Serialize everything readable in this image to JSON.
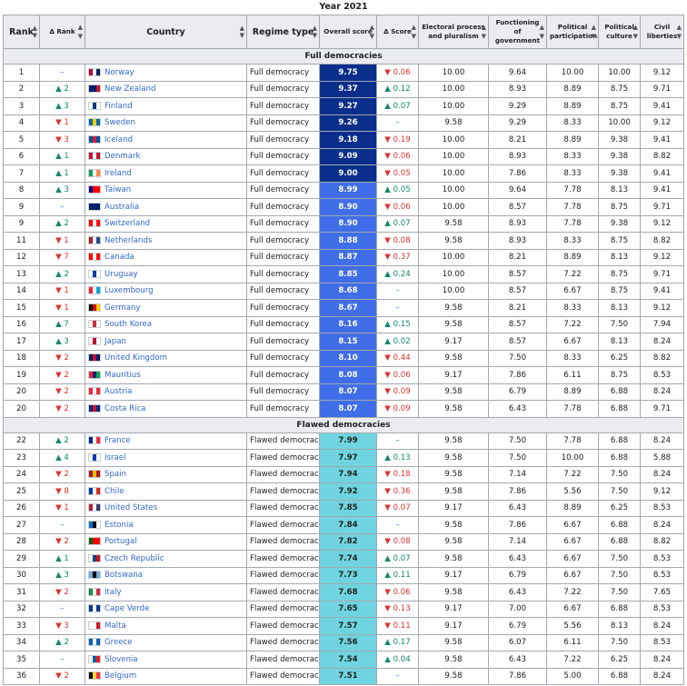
{
  "caption": "Year 2021",
  "columns": {
    "rank": "Rank",
    "delta_rank": "Δ Rank",
    "country": "Country",
    "regime": "Regime type",
    "overall": "Overall score",
    "delta_score": "Δ Score",
    "electoral": "Electoral process and pluralism",
    "functioning": "Functioning of government",
    "participation": "Political participation",
    "culture": "Political culture",
    "liberties": "Civil liberties"
  },
  "colors": {
    "full_dark": "#0b2e8a",
    "full_light": "#3f6ee8",
    "flawed": "#6fd4e0",
    "up": "#14866d",
    "down": "#d33333"
  },
  "sections": [
    {
      "label": "Full democracies",
      "rows": [
        {
          "rank": "1",
          "dr": "–",
          "country": "Norway",
          "regime": "Full democracy",
          "score": "9.75",
          "ds": "▼ 0.06",
          "e": "10.00",
          "f": "9.64",
          "p": "10.00",
          "c": "10.00",
          "l": "9.12",
          "flag": [
            "#ba0c2f",
            "#ffffff",
            "#00205b"
          ]
        },
        {
          "rank": "2",
          "dr": "▲ 2",
          "country": "New Zealand",
          "regime": "Full democracy",
          "score": "9.37",
          "ds": "▲ 0.12",
          "e": "10.00",
          "f": "8.93",
          "p": "8.89",
          "c": "8.75",
          "l": "9.71",
          "flag": [
            "#012169",
            "#012169",
            "#c8102e"
          ]
        },
        {
          "rank": "3",
          "dr": "▲ 3",
          "country": "Finland",
          "regime": "Full democracy",
          "score": "9.27",
          "ds": "▲ 0.07",
          "e": "10.00",
          "f": "9.29",
          "p": "8.89",
          "c": "8.75",
          "l": "9.41",
          "flag": [
            "#ffffff",
            "#003580",
            "#ffffff"
          ]
        },
        {
          "rank": "4",
          "dr": "▼ 1",
          "country": "Sweden",
          "regime": "Full democracy",
          "score": "9.26",
          "ds": "–",
          "e": "9.58",
          "f": "9.29",
          "p": "8.33",
          "c": "10.00",
          "l": "9.12",
          "flag": [
            "#006aa7",
            "#fecc00",
            "#006aa7"
          ]
        },
        {
          "rank": "5",
          "dr": "▼ 3",
          "country": "Iceland",
          "regime": "Full democracy",
          "score": "9.18",
          "ds": "▼ 0.19",
          "e": "10.00",
          "f": "8.21",
          "p": "8.89",
          "c": "9.38",
          "l": "9.41",
          "flag": [
            "#02529c",
            "#dc1e35",
            "#02529c"
          ]
        },
        {
          "rank": "6",
          "dr": "▲ 1",
          "country": "Denmark",
          "regime": "Full democracy",
          "score": "9.09",
          "ds": "▼ 0.06",
          "e": "10.00",
          "f": "8.93",
          "p": "8.33",
          "c": "9.38",
          "l": "8.82",
          "flag": [
            "#c8102e",
            "#ffffff",
            "#c8102e"
          ]
        },
        {
          "rank": "7",
          "dr": "▲ 1",
          "country": "Ireland",
          "regime": "Full democracy",
          "score": "9.00",
          "ds": "▼ 0.05",
          "e": "10.00",
          "f": "7.86",
          "p": "8.33",
          "c": "9.38",
          "l": "9.41",
          "flag": [
            "#169b62",
            "#ffffff",
            "#ff883e"
          ]
        },
        {
          "rank": "8",
          "dr": "▲ 3",
          "country": "Taiwan",
          "regime": "Full democracy",
          "score": "8.99",
          "ds": "▲ 0.05",
          "e": "10.00",
          "f": "9.64",
          "p": "7.78",
          "c": "8.13",
          "l": "9.41",
          "flag": [
            "#000095",
            "#fe0000",
            "#fe0000"
          ]
        },
        {
          "rank": "9",
          "dr": "–",
          "country": "Australia",
          "regime": "Full democracy",
          "score": "8.90",
          "ds": "▼ 0.06",
          "e": "10.00",
          "f": "8.57",
          "p": "7.78",
          "c": "8.75",
          "l": "9.71",
          "flag": [
            "#012169",
            "#012169",
            "#012169"
          ]
        },
        {
          "rank": "9",
          "dr": "▲ 2",
          "country": "Switzerland",
          "regime": "Full democracy",
          "score": "8.90",
          "ds": "▲ 0.07",
          "e": "9.58",
          "f": "8.93",
          "p": "7.78",
          "c": "9.38",
          "l": "9.12",
          "flag": [
            "#ff0000",
            "#ffffff",
            "#ff0000"
          ]
        },
        {
          "rank": "11",
          "dr": "▼ 1",
          "country": "Netherlands",
          "regime": "Full democracy",
          "score": "8.88",
          "ds": "▼ 0.08",
          "e": "9.58",
          "f": "8.93",
          "p": "8.33",
          "c": "8.75",
          "l": "8.82",
          "flag": [
            "#ae1c28",
            "#ffffff",
            "#21468b"
          ]
        },
        {
          "rank": "12",
          "dr": "▼ 7",
          "country": "Canada",
          "regime": "Full democracy",
          "score": "8.87",
          "ds": "▼ 0.37",
          "e": "10.00",
          "f": "8.21",
          "p": "8.89",
          "c": "8.13",
          "l": "9.12",
          "flag": [
            "#ff0000",
            "#ffffff",
            "#ff0000"
          ]
        },
        {
          "rank": "13",
          "dr": "▲ 2",
          "country": "Uruguay",
          "regime": "Full democracy",
          "score": "8.85",
          "ds": "▲ 0.24",
          "e": "10.00",
          "f": "8.57",
          "p": "7.22",
          "c": "8.75",
          "l": "9.71",
          "flag": [
            "#ffffff",
            "#0038a8",
            "#ffffff"
          ]
        },
        {
          "rank": "14",
          "dr": "▼ 1",
          "country": "Luxembourg",
          "regime": "Full democracy",
          "score": "8.68",
          "ds": "–",
          "e": "10.00",
          "f": "8.57",
          "p": "6.67",
          "c": "8.75",
          "l": "9.41",
          "flag": [
            "#ed2939",
            "#ffffff",
            "#00a1de"
          ]
        },
        {
          "rank": "15",
          "dr": "▼ 1",
          "country": "Germany",
          "regime": "Full democracy",
          "score": "8.67",
          "ds": "–",
          "e": "9.58",
          "f": "8.21",
          "p": "8.33",
          "c": "8.13",
          "l": "9.12",
          "flag": [
            "#000000",
            "#dd0000",
            "#ffce00"
          ]
        },
        {
          "rank": "16",
          "dr": "▲ 7",
          "country": "South Korea",
          "regime": "Full democracy",
          "score": "8.16",
          "ds": "▲ 0.15",
          "e": "9.58",
          "f": "8.57",
          "p": "7.22",
          "c": "7.50",
          "l": "7.94",
          "flag": [
            "#ffffff",
            "#cd2e3a",
            "#ffffff"
          ]
        },
        {
          "rank": "17",
          "dr": "▲ 3",
          "country": "Japan",
          "regime": "Full democracy",
          "score": "8.15",
          "ds": "▲ 0.02",
          "e": "9.17",
          "f": "8.57",
          "p": "6.67",
          "c": "8.13",
          "l": "8.24",
          "flag": [
            "#ffffff",
            "#bc002d",
            "#ffffff"
          ]
        },
        {
          "rank": "18",
          "dr": "▼ 2",
          "country": "United Kingdom",
          "regime": "Full democracy",
          "score": "8.10",
          "ds": "▼ 0.44",
          "e": "9.58",
          "f": "7.50",
          "p": "8.33",
          "c": "6.25",
          "l": "8.82",
          "flag": [
            "#012169",
            "#c8102e",
            "#012169"
          ]
        },
        {
          "rank": "19",
          "dr": "▼ 2",
          "country": "Mauritius",
          "regime": "Full democracy",
          "score": "8.08",
          "ds": "▼ 0.06",
          "e": "9.17",
          "f": "7.86",
          "p": "6.11",
          "c": "8.75",
          "l": "8.53",
          "flag": [
            "#ea2839",
            "#1a206d",
            "#00a551"
          ]
        },
        {
          "rank": "20",
          "dr": "▼ 2",
          "country": "Austria",
          "regime": "Full democracy",
          "score": "8.07",
          "ds": "▼ 0.09",
          "e": "9.58",
          "f": "6.79",
          "p": "8.89",
          "c": "6.88",
          "l": "8.24",
          "flag": [
            "#ed2939",
            "#ffffff",
            "#ed2939"
          ]
        },
        {
          "rank": "20",
          "dr": "▼ 2",
          "country": "Costa Rica",
          "regime": "Full democracy",
          "score": "8.07",
          "ds": "▼ 0.09",
          "e": "9.58",
          "f": "6.43",
          "p": "7.78",
          "c": "6.88",
          "l": "9.71",
          "flag": [
            "#002b7f",
            "#ce1126",
            "#002b7f"
          ]
        }
      ]
    },
    {
      "label": "Flawed democracies",
      "rows": [
        {
          "rank": "22",
          "dr": "▲ 2",
          "country": "France",
          "regime": "Flawed democracy",
          "score": "7.99",
          "ds": "–",
          "e": "9.58",
          "f": "7.50",
          "p": "7.78",
          "c": "6.88",
          "l": "8.24",
          "flag": [
            "#002395",
            "#ffffff",
            "#ed2939"
          ]
        },
        {
          "rank": "23",
          "dr": "▲ 4",
          "country": "Israel",
          "regime": "Flawed democracy",
          "score": "7.97",
          "ds": "▲ 0.13",
          "e": "9.58",
          "f": "7.50",
          "p": "10.00",
          "c": "6.88",
          "l": "5.88",
          "flag": [
            "#ffffff",
            "#0038b8",
            "#ffffff"
          ]
        },
        {
          "rank": "24",
          "dr": "▼ 2",
          "country": "Spain",
          "regime": "Flawed democracy",
          "score": "7.94",
          "ds": "▼ 0.18",
          "e": "9.58",
          "f": "7.14",
          "p": "7.22",
          "c": "7.50",
          "l": "8.24",
          "flag": [
            "#aa151b",
            "#f1bf00",
            "#aa151b"
          ]
        },
        {
          "rank": "25",
          "dr": "▼ 8",
          "country": "Chile",
          "regime": "Flawed democracy",
          "score": "7.92",
          "ds": "▼ 0.36",
          "e": "9.58",
          "f": "7.86",
          "p": "5.56",
          "c": "7.50",
          "l": "9.12",
          "flag": [
            "#0039a6",
            "#ffffff",
            "#d52b1e"
          ]
        },
        {
          "rank": "26",
          "dr": "▼ 1",
          "country": "United States",
          "regime": "Flawed democracy",
          "score": "7.85",
          "ds": "▼ 0.07",
          "e": "9.17",
          "f": "6.43",
          "p": "8.89",
          "c": "6.25",
          "l": "8.53",
          "flag": [
            "#b22234",
            "#ffffff",
            "#3c3b6e"
          ]
        },
        {
          "rank": "27",
          "dr": "–",
          "country": "Estonia",
          "regime": "Flawed democracy",
          "score": "7.84",
          "ds": "–",
          "e": "9.58",
          "f": "7.86",
          "p": "6.67",
          "c": "6.88",
          "l": "8.24",
          "flag": [
            "#0072ce",
            "#000000",
            "#ffffff"
          ]
        },
        {
          "rank": "28",
          "dr": "▼ 2",
          "country": "Portugal",
          "regime": "Flawed democracy",
          "score": "7.82",
          "ds": "▼ 0.08",
          "e": "9.58",
          "f": "7.14",
          "p": "6.67",
          "c": "6.88",
          "l": "8.82",
          "flag": [
            "#006600",
            "#ff0000",
            "#ff0000"
          ]
        },
        {
          "rank": "29",
          "dr": "▲ 1",
          "country": "Czech Republic",
          "regime": "Flawed democracy",
          "score": "7.74",
          "ds": "▲ 0.07",
          "e": "9.58",
          "f": "6.43",
          "p": "6.67",
          "c": "7.50",
          "l": "8.53",
          "flag": [
            "#ffffff",
            "#11457e",
            "#d7141a"
          ]
        },
        {
          "rank": "30",
          "dr": "▲ 3",
          "country": "Botswana",
          "regime": "Flawed democracy",
          "score": "7.73",
          "ds": "▲ 0.11",
          "e": "9.17",
          "f": "6.79",
          "p": "6.67",
          "c": "7.50",
          "l": "8.53",
          "flag": [
            "#75aadb",
            "#000000",
            "#75aadb"
          ]
        },
        {
          "rank": "31",
          "dr": "▼ 2",
          "country": "Italy",
          "regime": "Flawed democracy",
          "score": "7.68",
          "ds": "▼ 0.06",
          "e": "9.58",
          "f": "6.43",
          "p": "7.22",
          "c": "7.50",
          "l": "7.65",
          "flag": [
            "#009246",
            "#ffffff",
            "#ce2b37"
          ]
        },
        {
          "rank": "32",
          "dr": "–",
          "country": "Cape Verde",
          "regime": "Flawed democracy",
          "score": "7.65",
          "ds": "▼ 0.13",
          "e": "9.17",
          "f": "7.00",
          "p": "6.67",
          "c": "6.88",
          "l": "8.53",
          "flag": [
            "#003893",
            "#ffffff",
            "#003893"
          ]
        },
        {
          "rank": "33",
          "dr": "▼ 3",
          "country": "Malta",
          "regime": "Flawed democracy",
          "score": "7.57",
          "ds": "▼ 0.11",
          "e": "9.17",
          "f": "6.79",
          "p": "5.56",
          "c": "8.13",
          "l": "8.24",
          "flag": [
            "#ffffff",
            "#ffffff",
            "#cf142b"
          ]
        },
        {
          "rank": "34",
          "dr": "▲ 2",
          "country": "Greece",
          "regime": "Flawed democracy",
          "score": "7.56",
          "ds": "▲ 0.17",
          "e": "9.58",
          "f": "6.07",
          "p": "6.11",
          "c": "7.50",
          "l": "8.53",
          "flag": [
            "#0d5eaf",
            "#ffffff",
            "#0d5eaf"
          ]
        },
        {
          "rank": "35",
          "dr": "–",
          "country": "Slovenia",
          "regime": "Flawed democracy",
          "score": "7.54",
          "ds": "▲ 0.04",
          "e": "9.58",
          "f": "6.43",
          "p": "7.22",
          "c": "6.25",
          "l": "8.24",
          "flag": [
            "#ffffff",
            "#005da4",
            "#ed1c24"
          ]
        },
        {
          "rank": "36",
          "dr": "▼ 2",
          "country": "Belgium",
          "regime": "Flawed democracy",
          "score": "7.51",
          "ds": "–",
          "e": "9.58",
          "f": "7.86",
          "p": "5.00",
          "c": "6.88",
          "l": "8.24",
          "flag": [
            "#000000",
            "#fdda24",
            "#ef3340"
          ]
        }
      ]
    }
  ]
}
